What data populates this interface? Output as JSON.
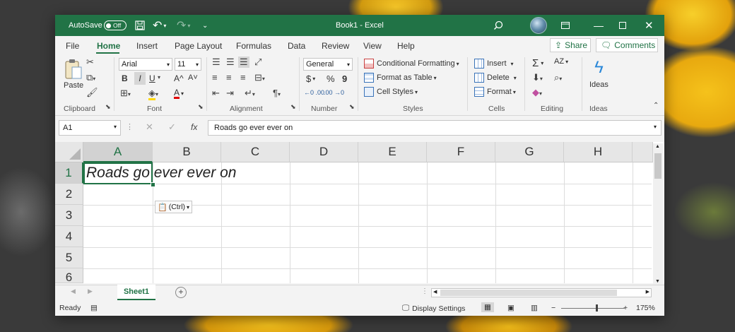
{
  "titlebar": {
    "autosave_label": "AutoSave",
    "autosave_state": "Off",
    "title": "Book1 - Excel",
    "icons": [
      "save-icon",
      "undo-icon",
      "redo-icon",
      "customize-icon",
      "search-icon",
      "avatar",
      "ribbon-display-icon",
      "minimize-icon",
      "maximize-icon",
      "close-icon"
    ]
  },
  "menu": {
    "tabs": [
      "File",
      "Home",
      "Insert",
      "Page Layout",
      "Formulas",
      "Data",
      "Review",
      "View",
      "Help"
    ],
    "active": "Home",
    "share_label": "Share",
    "comments_label": "Comments"
  },
  "ribbon": {
    "clipboard": {
      "label": "Clipboard",
      "paste_label": "Paste"
    },
    "font": {
      "label": "Font",
      "font_name": "Arial",
      "font_size": "11",
      "bold": "B",
      "italic": "I",
      "underline": "U",
      "grow": "A^",
      "shrink": "A˅",
      "font_color": "A"
    },
    "alignment": {
      "label": "Alignment"
    },
    "number": {
      "label": "Number",
      "format": "General",
      "currency": "$",
      "percent": "%",
      "comma": "9",
      "inc_dec": "←0 .00",
      "dec_dec": ".00 →0"
    },
    "styles": {
      "label": "Styles",
      "conditional": "Conditional Formatting",
      "format_table": "Format as Table",
      "cell_styles": "Cell Styles"
    },
    "cells": {
      "label": "Cells",
      "insert": "Insert",
      "delete": "Delete",
      "format": "Format"
    },
    "editing": {
      "label": "Editing",
      "sum": "Σ",
      "sort": "AZ"
    },
    "ideas": {
      "label": "Ideas",
      "button": "Ideas"
    }
  },
  "formula_bar": {
    "name_box": "A1",
    "fx": "fx",
    "value": "Roads go ever ever on"
  },
  "grid": {
    "columns": [
      "A",
      "B",
      "C",
      "D",
      "E",
      "F",
      "G",
      "H"
    ],
    "rows": [
      "1",
      "2",
      "3",
      "4",
      "5",
      "6"
    ],
    "selected_col": "A",
    "selected_row": "1",
    "cell_a1": "Roads go ever ever on",
    "paste_options_label": "(Ctrl)"
  },
  "sheets": {
    "tabs": [
      "Sheet1"
    ],
    "active": "Sheet1"
  },
  "status": {
    "ready": "Ready",
    "display_settings": "Display Settings",
    "zoom_minus": "−",
    "zoom_plus": "+",
    "zoom": "175%"
  },
  "colors": {
    "excel_green": "#217346",
    "title_text": "#ffffff"
  }
}
